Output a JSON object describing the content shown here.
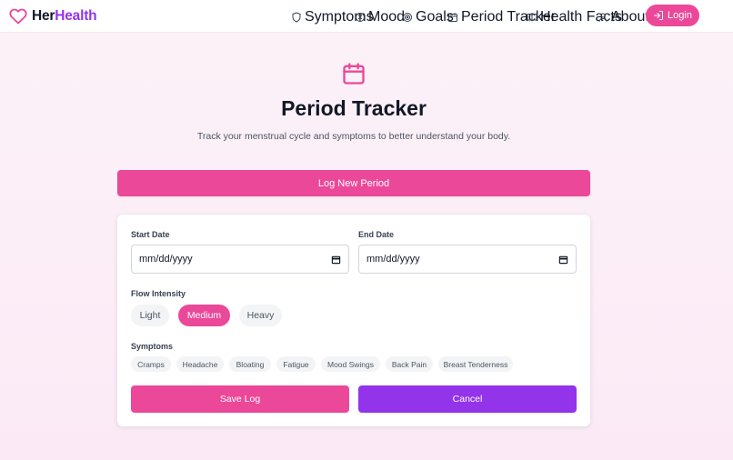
{
  "brand": {
    "part1": "Her",
    "part2": "Health"
  },
  "nav": {
    "items": [
      {
        "label": "Symptoms",
        "icon": "shield-icon"
      },
      {
        "label": "Mood",
        "icon": "brain-icon"
      },
      {
        "label": "Goals",
        "icon": "target-icon"
      },
      {
        "label": "Period Tracker",
        "icon": "calendar-icon"
      },
      {
        "label": "Health Facts",
        "icon": "book-icon"
      },
      {
        "label": "About",
        "icon": "user-icon"
      }
    ],
    "login_label": "Login"
  },
  "hero": {
    "title": "Period Tracker",
    "subtitle": "Track your menstrual cycle and symptoms to better understand your body."
  },
  "log_button": "Log New Period",
  "form": {
    "start_label": "Start Date",
    "start_value": "mm/dd/yyyy",
    "end_label": "End Date",
    "end_value": "mm/dd/yyyy",
    "flow_label": "Flow Intensity",
    "flow_options": [
      "Light",
      "Medium",
      "Heavy"
    ],
    "flow_selected": "Medium",
    "symptoms_label": "Symptoms",
    "symptoms": [
      "Cramps",
      "Headache",
      "Bloating",
      "Fatigue",
      "Mood Swings",
      "Back Pain",
      "Breast Tenderness"
    ],
    "save_label": "Save Log",
    "cancel_label": "Cancel"
  },
  "colors": {
    "pink": "#ec4899",
    "purple": "#9333ea",
    "background": "#fdf2f8"
  }
}
